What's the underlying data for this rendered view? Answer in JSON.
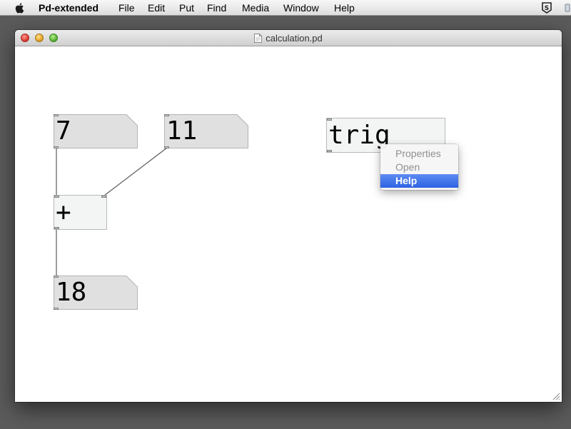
{
  "menubar": {
    "apple_icon": "apple-logo-icon",
    "app_name": "Pd-extended",
    "items": [
      "File",
      "Edit",
      "Put",
      "Find",
      "Media",
      "Window",
      "Help"
    ],
    "tray_icon": "script-s-icon"
  },
  "window": {
    "title": "calculation.pd",
    "document_icon": "pd-document-icon"
  },
  "patch": {
    "number_a": "7",
    "number_b": "11",
    "plus_object": "+",
    "result_number": "18",
    "trigger_object": "trig"
  },
  "context_menu": {
    "items": [
      {
        "label": "Properties",
        "state": "disabled"
      },
      {
        "label": "Open",
        "state": "disabled"
      },
      {
        "label": "Help",
        "state": "highlighted"
      }
    ],
    "highlight_color": "#3a6ff0"
  },
  "colors": {
    "desktop": "#5b5b5b",
    "object_fill": "#f3f5f4",
    "atom_fill": "#e0e0e0"
  }
}
